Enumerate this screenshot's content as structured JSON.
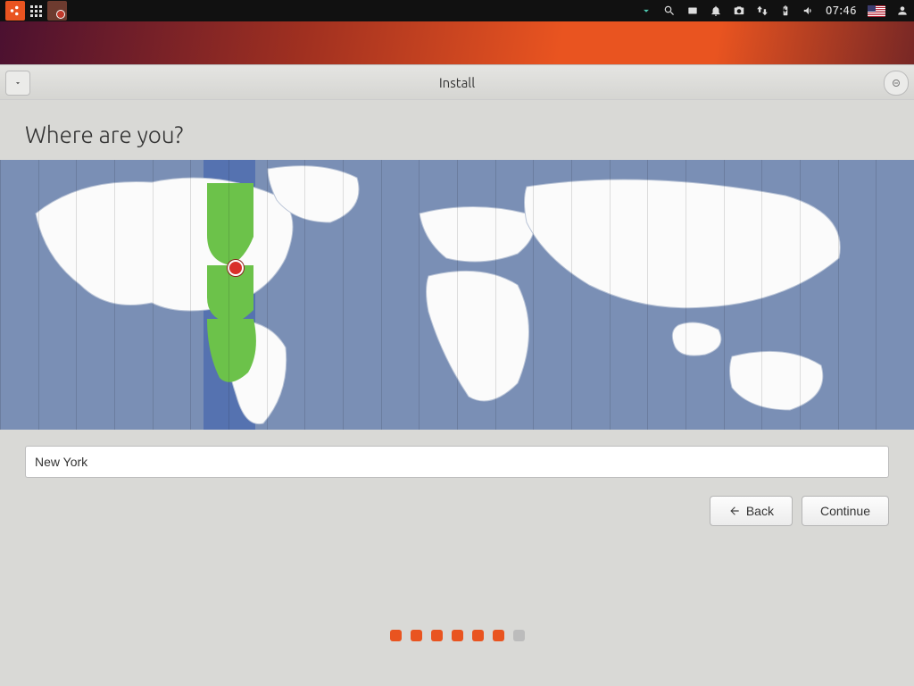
{
  "panel": {
    "clock": "07:46",
    "locale_flag": "US"
  },
  "window": {
    "title": "Install",
    "heading": "Where are you?",
    "timezone_value": "New York",
    "back_label": "Back",
    "continue_label": "Continue",
    "progress": {
      "total": 7,
      "inactive_index": 6
    }
  },
  "map": {
    "selected_timezone_band": "UTC−05:00",
    "marker_city": "New York"
  }
}
